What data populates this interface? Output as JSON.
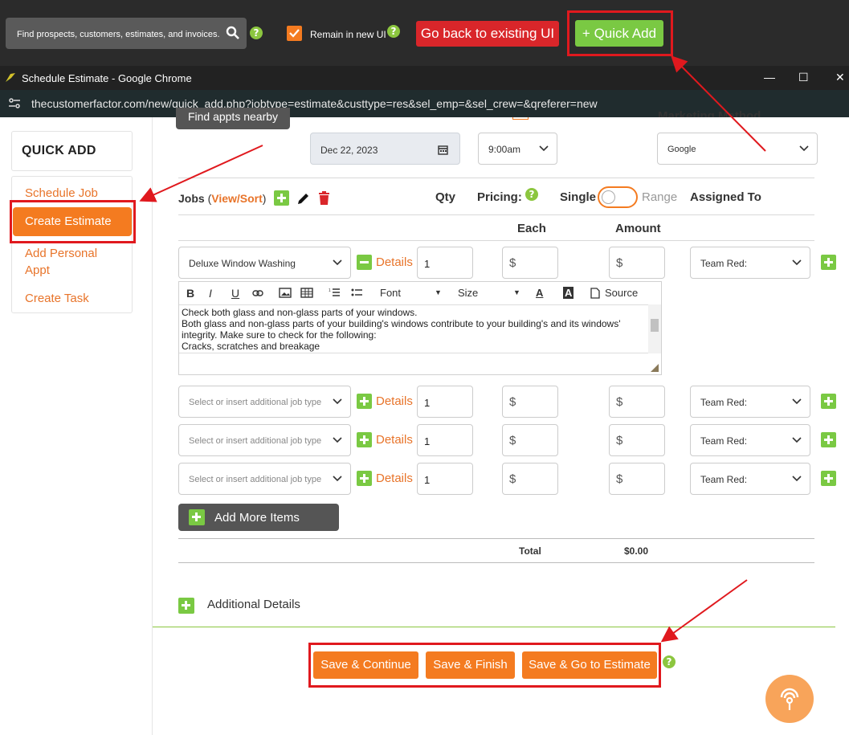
{
  "topbar": {
    "search_placeholder": "Find prospects, customers, estimates, and invoices.",
    "remain_label": "Remain in new UI",
    "go_back_label": "Go back to existing UI",
    "quick_add_label": "+ Quick Add",
    "help_glyph": "?"
  },
  "chrome": {
    "title": "Schedule Estimate - Google Chrome",
    "url": "thecustomerfactor.com/new/quick_add.php?jobtype=estimate&custtype=res&sel_emp=&sel_crew=&qreferer=new",
    "minimize": "—",
    "maximize": "☐",
    "close": "✕"
  },
  "sidebar": {
    "heading": "QUICK ADD",
    "items": [
      {
        "label": "Schedule Job"
      },
      {
        "label": "Create Estimate"
      },
      {
        "label": "Add Personal Appt"
      },
      {
        "label": "Create Task"
      }
    ]
  },
  "schedule": {
    "find_appts": "Find appts nearby",
    "date": "Dec 22, 2023",
    "time": "9:00am",
    "marketing_label": "Marketing Method",
    "marketing_value": "Google"
  },
  "jobs": {
    "label": "Jobs",
    "view_sort": "View/Sort",
    "paren_open": "(",
    "paren_close": ")",
    "qty_header": "Qty",
    "pricing_header": "Pricing:",
    "single_label": "Single",
    "range_label": "Range",
    "assigned_header": "Assigned To",
    "each_header": "Each",
    "amount_header": "Amount",
    "details_label": "Details",
    "currency": "$",
    "rows": [
      {
        "job": "Deluxe Window Washing",
        "qty": "1",
        "assigned": "Team Red:"
      },
      {
        "job": "Select or insert additional job type",
        "qty": "1",
        "assigned": "Team Red:"
      },
      {
        "job": "Select or insert additional job type",
        "qty": "1",
        "assigned": "Team Red:"
      },
      {
        "job": "Select or insert additional job type",
        "qty": "1",
        "assigned": "Team Red:"
      }
    ],
    "editor": {
      "font_label": "Font",
      "size_label": "Size",
      "source_label": "Source",
      "bold": "B",
      "italic": "I",
      "underline": "U",
      "text_color": "A",
      "bg_color": "A",
      "lines": [
        "Check both glass and non-glass parts of your windows.",
        "Both glass and non-glass parts of your building's windows contribute to your building's and its windows'",
        "integrity. Make sure to check for the following:",
        "Cracks, scratches and breakage"
      ]
    },
    "add_more_label": "Add More Items",
    "total_label": "Total",
    "total_value": "$0.00"
  },
  "additional_details_label": "Additional Details",
  "actions": {
    "save_continue": "Save & Continue",
    "save_finish": "Save & Finish",
    "save_goto_estimate": "Save & Go to Estimate"
  },
  "colors": {
    "orange": "#f47b20",
    "green": "#7ac943",
    "highlight_red": "#e0191e",
    "back_red": "#d9262a"
  }
}
